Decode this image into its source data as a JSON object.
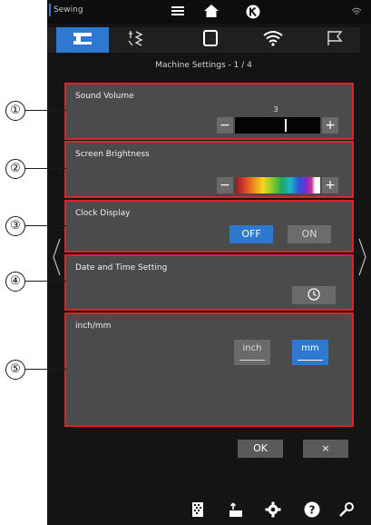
{
  "status_bar": {
    "mode_label": "Sewing",
    "icons": [
      "menu-icon",
      "home-icon",
      "k-logo-icon",
      "wifi-signal-icon"
    ]
  },
  "tabs": [
    {
      "icon": "sewing-machine-icon",
      "active": true
    },
    {
      "icon": "stitch-pattern-icon",
      "active": false
    },
    {
      "icon": "frame-icon",
      "active": false
    },
    {
      "icon": "wifi-icon",
      "active": false
    },
    {
      "icon": "flag-icon",
      "active": false
    }
  ],
  "page_title": "Machine Settings  -  1 / 4",
  "settings": {
    "sound_volume": {
      "label": "Sound Volume",
      "value": "3",
      "level": 0.6,
      "minus": "−",
      "plus": "+"
    },
    "screen_brightness": {
      "label": "Screen Brightness",
      "minus": "−",
      "plus": "+"
    },
    "clock_display": {
      "label": "Clock Display",
      "off_label": "OFF",
      "on_label": "ON",
      "selected": "OFF"
    },
    "date_time": {
      "label": "Date and Time Setting",
      "icon": "clock-icon"
    },
    "units": {
      "label": "inch/mm",
      "inch_label": "inch",
      "mm_label": "mm",
      "selected": "mm"
    }
  },
  "actions": {
    "ok_label": "OK",
    "cancel_label": "×"
  },
  "bottom_bar": {
    "icons": [
      "pattern-icon",
      "thread-upload-icon",
      "settings-gear-icon",
      "help-icon",
      "wrench-icon"
    ]
  },
  "callouts": [
    "①",
    "②",
    "③",
    "④",
    "⑤"
  ],
  "colors": {
    "accent": "#2f78d0",
    "highlight_border": "#e0202a",
    "panel": "#4b4b4b",
    "background": "#141414"
  }
}
